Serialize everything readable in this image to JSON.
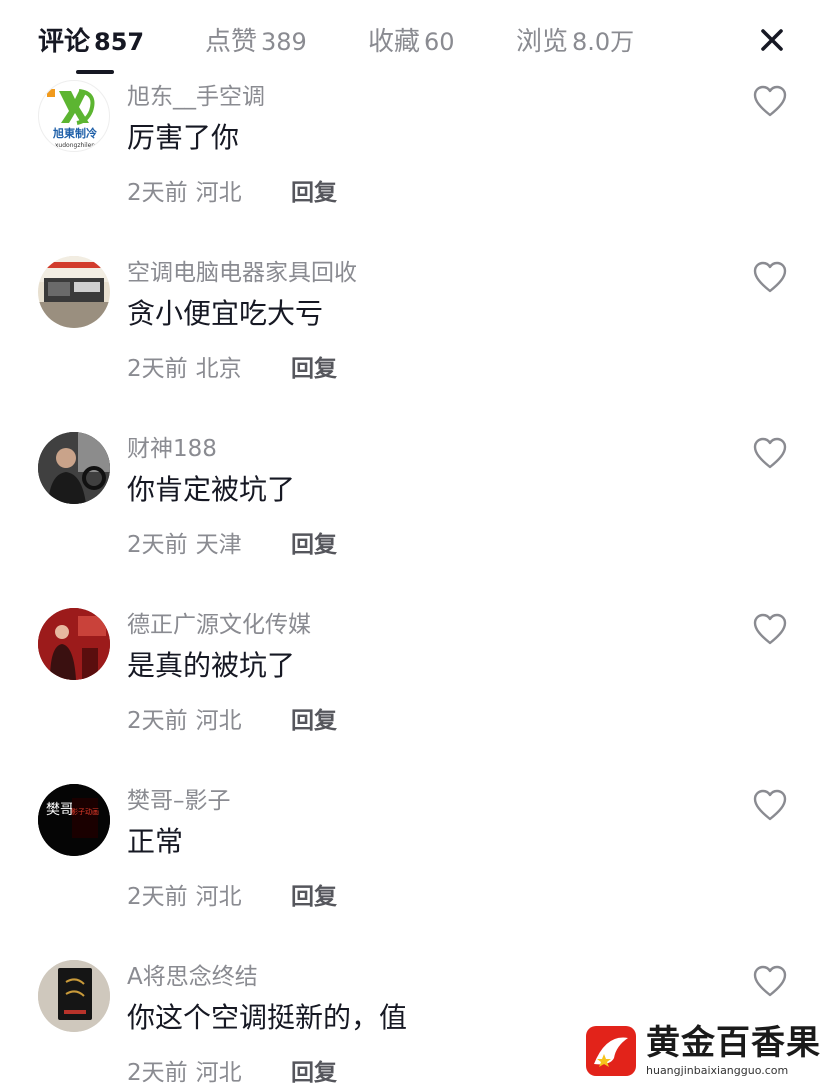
{
  "tabs": [
    {
      "label": "评论",
      "count": "857"
    },
    {
      "label": "点赞",
      "count": "389"
    },
    {
      "label": "收藏",
      "count": "60"
    },
    {
      "label": "浏览",
      "count": "8.0万"
    }
  ],
  "close_icon": "close-icon",
  "comments": [
    {
      "username": "旭东__手空调",
      "text": "厉害了你",
      "time": "2天前",
      "location": "河北",
      "reply": "回复",
      "avatar_text": "旭東制冷",
      "avatar_sub": "xudongzhilen"
    },
    {
      "username": "空调电脑电器家具回收",
      "text": "贪小便宜吃大亏",
      "time": "2天前",
      "location": "北京",
      "reply": "回复"
    },
    {
      "username": "财神188",
      "text": "你肯定被坑了",
      "time": "2天前",
      "location": "天津",
      "reply": "回复"
    },
    {
      "username": "德正广源文化传媒",
      "text": "是真的被坑了",
      "time": "2天前",
      "location": "河北",
      "reply": "回复"
    },
    {
      "username": "樊哥–影子",
      "text": "正常",
      "time": "2天前",
      "location": "河北",
      "reply": "回复",
      "avatar_text": "樊哥",
      "avatar_sub": "影子动画"
    },
    {
      "username": "A将思念终结",
      "text": "你这个空调挺新的，值",
      "time": "2天前",
      "location": "河北",
      "reply": "回复"
    }
  ],
  "watermark": {
    "title": "黄金百香果",
    "url": "huangjinbaixiangguo.com"
  },
  "colors": {
    "text_primary": "#161823",
    "text_secondary": "#8a8b91",
    "background": "#ffffff",
    "watermark_red": "#e2231a"
  }
}
